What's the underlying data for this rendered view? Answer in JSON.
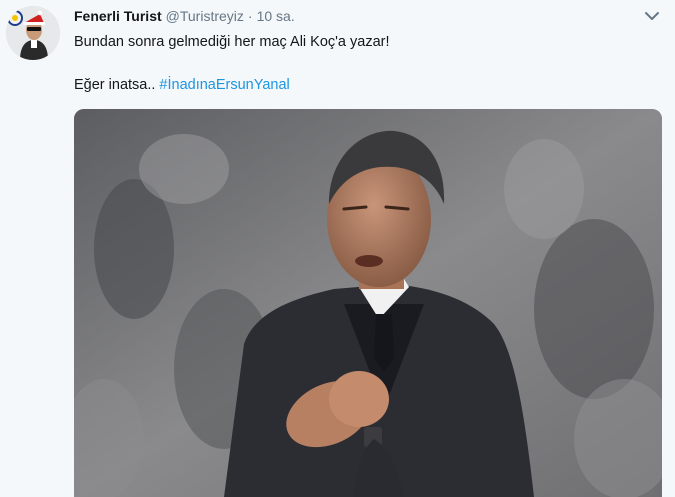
{
  "tweet": {
    "display_name": "Fenerli Turist",
    "handle": "@Turistreyiz",
    "separator": "·",
    "time": "10 sa.",
    "line1": "Bundan sonra gelmediği her maç Ali Koç'a yazar!",
    "line2": "Eğer inatsa..",
    "hashtag": "#İnadınaErsunYanal"
  },
  "icons": {
    "more": "chevron-down-icon",
    "avatar": "avatar"
  },
  "colors": {
    "background": "#f5f8fa",
    "link": "#1b95e0",
    "name": "#14171a",
    "muted": "#657786"
  }
}
